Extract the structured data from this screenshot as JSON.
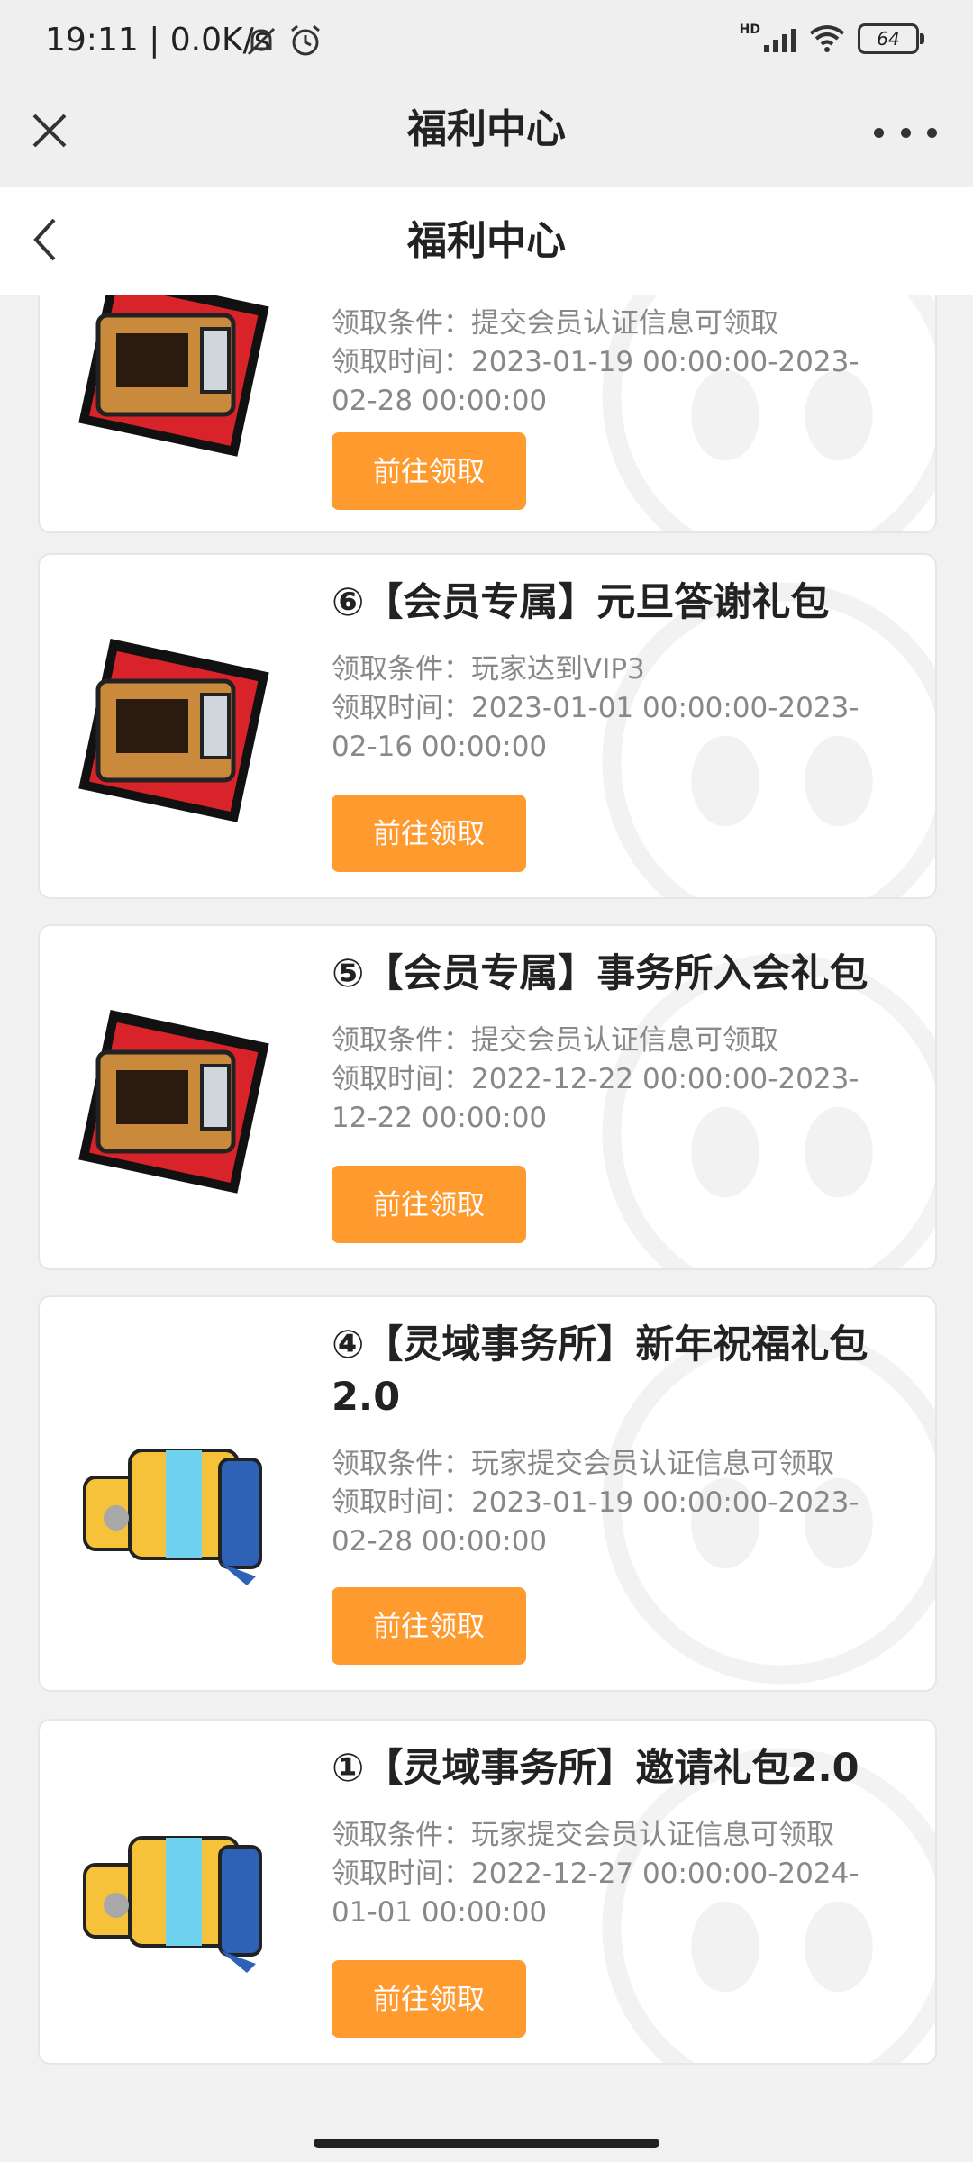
{
  "status_bar": {
    "time": "19:11 | 0.0K/s",
    "hd": "HD",
    "battery": "64"
  },
  "mp_header": {
    "title": "福利中心"
  },
  "page": {
    "title": "福利中心"
  },
  "cards": [
    {
      "title": "",
      "condition": "领取条件：提交会员认证信息可领取",
      "time": "领取时间：2023-01-19 00:00:00-2023-02-28 00:00:00",
      "button": "前往领取",
      "icon": "gift-box-icon"
    },
    {
      "title": "⑥【会员专属】元旦答谢礼包",
      "condition": "领取条件：玩家达到VIP3",
      "time": "领取时间：2023-01-01 00:00:00-2023-02-16 00:00:00",
      "button": "前往领取",
      "icon": "gift-box-icon"
    },
    {
      "title": "⑤【会员专属】事务所入会礼包",
      "condition": "领取条件：提交会员认证信息可领取",
      "time": "领取时间：2022-12-22 00:00:00-2023-12-22 00:00:00",
      "button": "前往领取",
      "icon": "gift-box-icon"
    },
    {
      "title": "④【灵域事务所】新年祝福礼包2.0",
      "condition": "领取条件：玩家提交会员认证信息可领取",
      "time": "领取时间：2023-01-19 00:00:00-2023-02-28 00:00:00",
      "button": "前往领取",
      "icon": "gift-bags-icon"
    },
    {
      "title": "①【灵域事务所】邀请礼包2.0",
      "condition": "领取条件：玩家提交会员认证信息可领取",
      "time": "领取时间：2022-12-27 00:00:00-2024-01-01 00:00:00",
      "button": "前往领取",
      "icon": "gift-bags-icon"
    }
  ],
  "colors": {
    "accent": "#ff9a2e",
    "gift_red": "#d8232a",
    "bag_yellow": "#f5c23a",
    "bag_blue": "#2e62b7"
  }
}
